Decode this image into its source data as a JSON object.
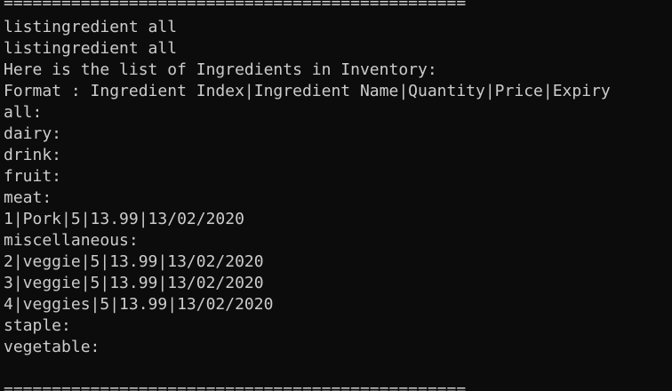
{
  "terminal": {
    "divider_top": "================================================",
    "lines": [
      "listingredient all",
      "listingredient all",
      "Here is the list of Ingredients in Inventory:",
      "Format : Ingredient Index|Ingredient Name|Quantity|Price|Expiry",
      "all:",
      "dairy:",
      "drink:",
      "fruit:",
      "meat:",
      "1|Pork|5|13.99|13/02/2020",
      "miscellaneous:",
      "2|veggie|5|13.99|13/02/2020",
      "3|veggie|5|13.99|13/02/2020",
      "4|veggies|5|13.99|13/02/2020",
      "staple:",
      "vegetable:"
    ],
    "divider_bottom": "================================================",
    "colors": {
      "background": "#0c0c0c",
      "text": "#cccccc"
    }
  }
}
